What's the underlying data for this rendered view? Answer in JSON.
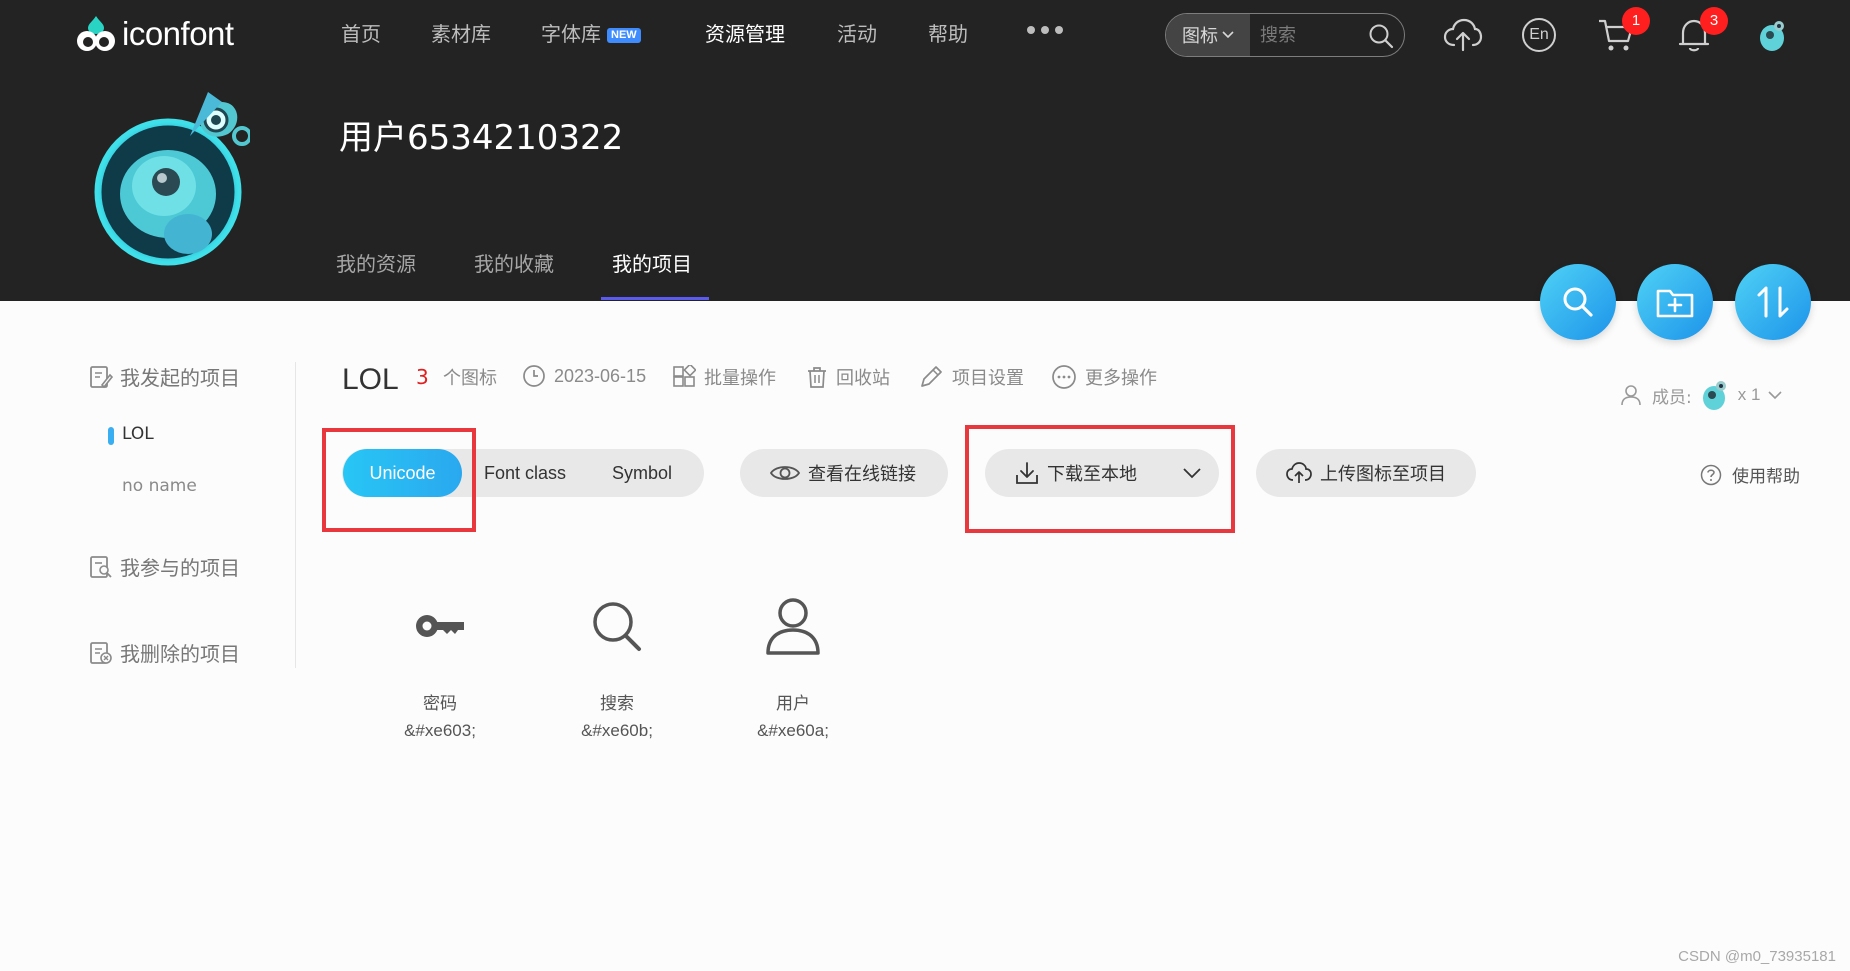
{
  "brand": {
    "name": "iconfont"
  },
  "nav": {
    "items": [
      {
        "label": "首页"
      },
      {
        "label": "素材库"
      },
      {
        "label": "字体库",
        "badge": "NEW"
      },
      {
        "label": "资源管理",
        "active": true
      },
      {
        "label": "活动"
      },
      {
        "label": "帮助"
      }
    ]
  },
  "search": {
    "type_label": "图标",
    "placeholder": "搜索"
  },
  "header_icons": {
    "upload": "cloud-upload-icon",
    "language": "En",
    "cart_count": "1",
    "bell_count": "3"
  },
  "user": {
    "name": "用户6534210322"
  },
  "subtabs": [
    {
      "label": "我的资源"
    },
    {
      "label": "我的收藏"
    },
    {
      "label": "我的项目",
      "active": true
    }
  ],
  "sidebar": {
    "created_label": "我发起的项目",
    "projects": [
      {
        "label": "LOL",
        "active": true
      },
      {
        "label": "no name"
      }
    ],
    "joined_label": "我参与的项目",
    "deleted_label": "我删除的项目"
  },
  "project": {
    "title": "LOL",
    "count": "3",
    "count_unit": "个图标",
    "date": "2023-06-15",
    "batch_label": "批量操作",
    "recycle_label": "回收站",
    "settings_label": "项目设置",
    "more_label": "更多操作",
    "members_label": "成员:",
    "members_count": "x 1"
  },
  "toolbar": {
    "formats": [
      {
        "label": "Unicode",
        "active": true
      },
      {
        "label": "Font class"
      },
      {
        "label": "Symbol"
      }
    ],
    "view_link_label": "查看在线链接",
    "download_label": "下载至本地",
    "upload_label": "上传图标至项目",
    "help_label": "使用帮助"
  },
  "icons": [
    {
      "name": "密码",
      "code": "&#xe603;",
      "icon": "key-icon"
    },
    {
      "name": "搜索",
      "code": "&#xe60b;",
      "icon": "search-icon"
    },
    {
      "name": "用户",
      "code": "&#xe60a;",
      "icon": "user-icon"
    }
  ],
  "watermark": "CSDN @m0_73935181",
  "colors": {
    "header_bg": "#232323",
    "accent": "#2aa8ef",
    "tab_underline": "#5b5bf0",
    "count_red": "#e02020",
    "annotation_red": "#e8383d"
  }
}
